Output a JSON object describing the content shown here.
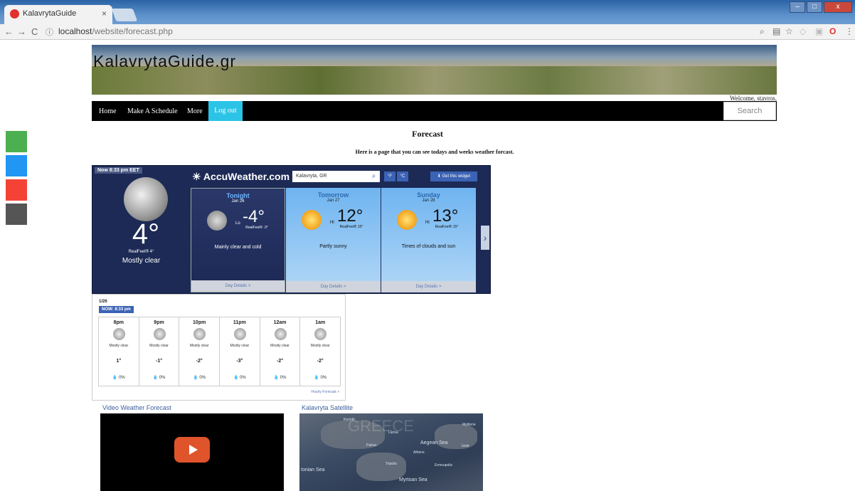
{
  "browser": {
    "tab_title": "KalavrytaGuide",
    "tab_close": "×",
    "url_host": "localhost",
    "url_path": "/website/forecast.php",
    "win_minimize": "–",
    "win_maximize": "□",
    "win_close": "x"
  },
  "site": {
    "title": "KalavrytaGuide.gr",
    "welcome": "Welcome, stavros.",
    "nav": [
      "Home",
      "Make A Schedule",
      "More"
    ],
    "logout": "Log out",
    "search_placeholder": "Search",
    "social_colors": [
      "#4caf50",
      "#2196f3",
      "#f44336",
      "#555555"
    ]
  },
  "page": {
    "heading": "Forecast",
    "subtitle": "Here is a page that you can see todays and weeks weather forcast."
  },
  "widget": {
    "now_label": "Now 8:33 pm EET",
    "current_temp": "4°",
    "current_realfeel": "RealFeel® 4°",
    "current_condition": "Mostly clear",
    "brand": "AccuWeather.com",
    "location": "Kalavryta, GR",
    "unit_f": "°F",
    "unit_c": "°C",
    "get_widget": "⬇ Get this widget",
    "days": [
      {
        "name": "Tonight",
        "date": "Jan 26",
        "hl": "Lo",
        "temp": "-4°",
        "realfeel": "RealFeel® -3°",
        "condition": "Mainly clear and cold",
        "details": "Day Details >"
      },
      {
        "name": "Tomorrow",
        "date": "Jan 27",
        "hl": "Hi",
        "temp": "12°",
        "realfeel": "RealFeel® 15°",
        "condition": "Partly sunny",
        "details": "Day Details >"
      },
      {
        "name": "Sunday",
        "date": "Jan 28",
        "hl": "Hi",
        "temp": "13°",
        "realfeel": "RealFeel® 15°",
        "condition": "Times of clouds and sun",
        "details": "Day Details >"
      }
    ],
    "next_arrow": "›"
  },
  "hourly": {
    "date": "1/26",
    "now_badge": "NOW: 8:33 pm",
    "hours": [
      {
        "time": "8pm",
        "cond": "Mostly clear",
        "temp": "1°",
        "precip": "0%"
      },
      {
        "time": "9pm",
        "cond": "Mostly clear",
        "temp": "-1°",
        "precip": "0%"
      },
      {
        "time": "10pm",
        "cond": "Mostly clear",
        "temp": "-2°",
        "precip": "0%"
      },
      {
        "time": "11pm",
        "cond": "Mostly clear",
        "temp": "-3°",
        "precip": "0%"
      },
      {
        "time": "12am",
        "cond": "Mostly clear",
        "temp": "-2°",
        "precip": "0%"
      },
      {
        "time": "1am",
        "cond": "Mostly clear",
        "temp": "-2°",
        "precip": "0%"
      }
    ],
    "link": "Hourly Forecast >"
  },
  "media": {
    "video_title": "Video Weather Forecast",
    "satellite_title": "Kalavryta Satellite",
    "map_labels": [
      "GREECE",
      "Larisa",
      "Aegean Sea",
      "Izmir",
      "Patras",
      "Athens",
      "Tripolis",
      "Ermoupolis",
      "Myrtoan Sea",
      "Ionian Sea",
      "Mytilene",
      "Korinth"
    ]
  }
}
